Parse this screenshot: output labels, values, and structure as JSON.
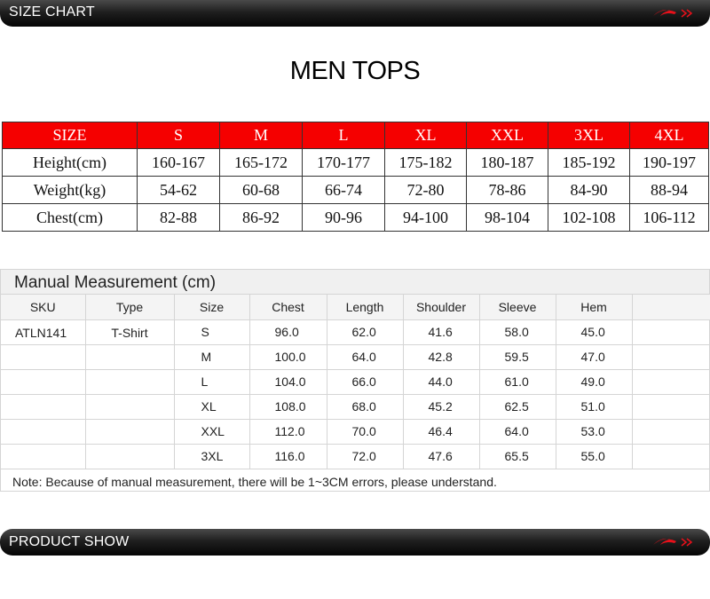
{
  "header_banner": {
    "title": "SIZE CHART"
  },
  "heading": "MEN TOPS",
  "size_table": {
    "header": [
      "SIZE",
      "S",
      "M",
      "L",
      "XL",
      "XXL",
      "3XL",
      "4XL"
    ],
    "rows": [
      [
        "Height(cm)",
        "160-167",
        "165-172",
        "170-177",
        "175-182",
        "180-187",
        "185-192",
        "190-197"
      ],
      [
        "Weight(kg)",
        "54-62",
        "60-68",
        "66-74",
        "72-80",
        "78-86",
        "84-90",
        "88-94"
      ],
      [
        "Chest(cm)",
        "82-88",
        "86-92",
        "90-96",
        "94-100",
        "98-104",
        "102-108",
        "106-112"
      ]
    ]
  },
  "manual": {
    "title": "Manual Measurement (cm)",
    "columns": [
      "SKU",
      "Type",
      "Size",
      "Chest",
      "Length",
      "Shoulder",
      "Sleeve",
      "Hem",
      ""
    ],
    "sku": "ATLN141",
    "type": "T-Shirt",
    "rows": [
      [
        "S",
        "96.0",
        "62.0",
        "41.6",
        "58.0",
        "45.0"
      ],
      [
        "M",
        "100.0",
        "64.0",
        "42.8",
        "59.5",
        "47.0"
      ],
      [
        "L",
        "104.0",
        "66.0",
        "44.0",
        "61.0",
        "49.0"
      ],
      [
        "XL",
        "108.0",
        "68.0",
        "45.2",
        "62.5",
        "51.0"
      ],
      [
        "XXL",
        "112.0",
        "70.0",
        "46.4",
        "64.0",
        "53.0"
      ],
      [
        "3XL",
        "116.0",
        "72.0",
        "47.6",
        "65.5",
        "55.0"
      ]
    ],
    "note": "Note: Because of manual measurement, there will be 1~3CM errors, please understand."
  },
  "footer_banner": {
    "title": "PRODUCT SHOW"
  },
  "colors": {
    "accent_red": "#f50000",
    "logo_red": "#e8101a",
    "banner_dark": "#111111"
  },
  "icons": {
    "brand_logo": "brand-logo-icon"
  }
}
